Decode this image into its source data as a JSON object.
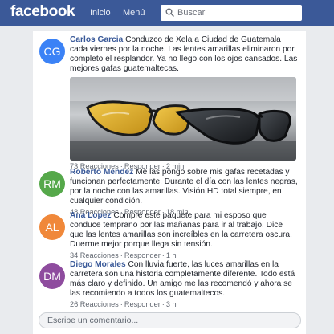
{
  "header": {
    "logo": "facebook",
    "nav": [
      "Inicio",
      "Menú"
    ],
    "search_placeholder": "Buscar"
  },
  "comments": [
    {
      "initials": "CG",
      "avatar_color": "#3b82f6",
      "author": "Carlos Garcia",
      "text": "Conduzco de Xela a Ciudad de Guatemala cada viernes por la noche. Las lentes amarillas eliminaron por completo el resplandor. Ya no llego con los ojos cansados. Las mejores gafas guatemaltecas.",
      "reactions": "73 Reacciones",
      "reply": "Responder",
      "time": "2 min"
    },
    {
      "initials": "RM",
      "avatar_color": "#55a84a",
      "author": "Roberto Mendez",
      "text": "Me las pongo sobre mis gafas recetadas y funcionan perfectamente. Durante el día con las lentes negras, por la noche con las amarillas. Visión HD total siempre, en cualquier condición.",
      "reactions": "48 Reacciones",
      "reply": "Responder",
      "time": "18 min"
    },
    {
      "initials": "AL",
      "avatar_color": "#f0883a",
      "author": "Ana Lopez",
      "text": "Compré este paquete para mi esposo que conduce temprano por las mañanas para ir al trabajo. Dice que las lentes amarillas son increíbles en la carretera oscura. Duerme mejor porque llega sin tensión.",
      "reactions": "34 Reacciones",
      "reply": "Responder",
      "time": "1 h"
    },
    {
      "initials": "DM",
      "avatar_color": "#8e4c9e",
      "author": "Diego Morales",
      "text": "Con lluvia fuerte, las luces amarillas en la carretera son una historia completamente diferente. Todo está más claro y definido. Un amigo me las recomendó y ahora se las recomiendo a todos los guatemaltecos.",
      "reactions": "26 Reacciones",
      "reply": "Responder",
      "time": "3 h"
    }
  ],
  "composer": {
    "placeholder": "Escribe un comentario..."
  },
  "colors": {
    "brand": "#3b5998",
    "link": "#385898"
  }
}
